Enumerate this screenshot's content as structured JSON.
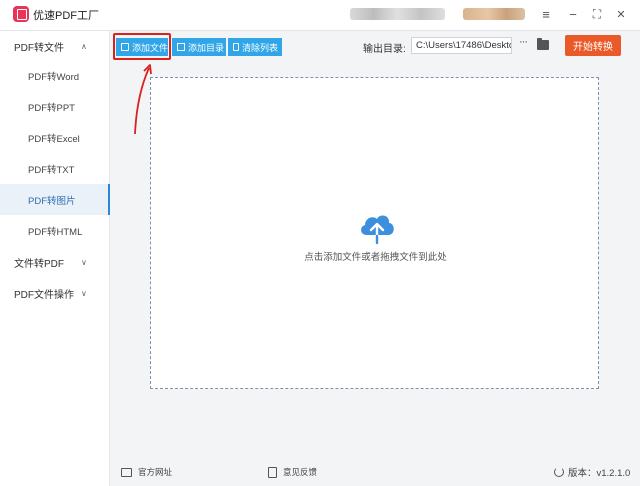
{
  "app": {
    "title": "优速PDF工厂",
    "brand_color": "#e8335b"
  },
  "window_controls": {
    "menu_icon": "≡",
    "minimize_icon": "−",
    "maximize_icon": "⛶",
    "close_icon": "✕"
  },
  "sidebar": {
    "groups": [
      {
        "label": "PDF转文件",
        "chevron": "∧"
      },
      {
        "label": "文件转PDF",
        "chevron": "∨"
      },
      {
        "label": "PDF文件操作",
        "chevron": "∨"
      }
    ],
    "items": [
      {
        "label": "PDF转Word"
      },
      {
        "label": "PDF转PPT"
      },
      {
        "label": "PDF转Excel"
      },
      {
        "label": "PDF转TXT"
      },
      {
        "label": "PDF转图片",
        "active": true
      },
      {
        "label": "PDF转HTML"
      }
    ]
  },
  "toolbar": {
    "add_file": "添加文件",
    "add_dir": "添加目录",
    "clear_list": "清除列表",
    "button_color": "#30a6e8"
  },
  "output": {
    "label": "输出目录:",
    "path": "C:\\Users\\17486\\Deskto",
    "more": "···",
    "convert": "开始转换",
    "convert_color": "#ea5a28"
  },
  "dropzone": {
    "hint": "点击添加文件或者拖拽文件到此处",
    "icon": "cloud-upload-icon"
  },
  "footer": {
    "website": "官方网址",
    "feedback": "意见反馈",
    "version": "版本：v1.2.1.0"
  },
  "annotation": {
    "highlight_color": "#d9221d"
  }
}
